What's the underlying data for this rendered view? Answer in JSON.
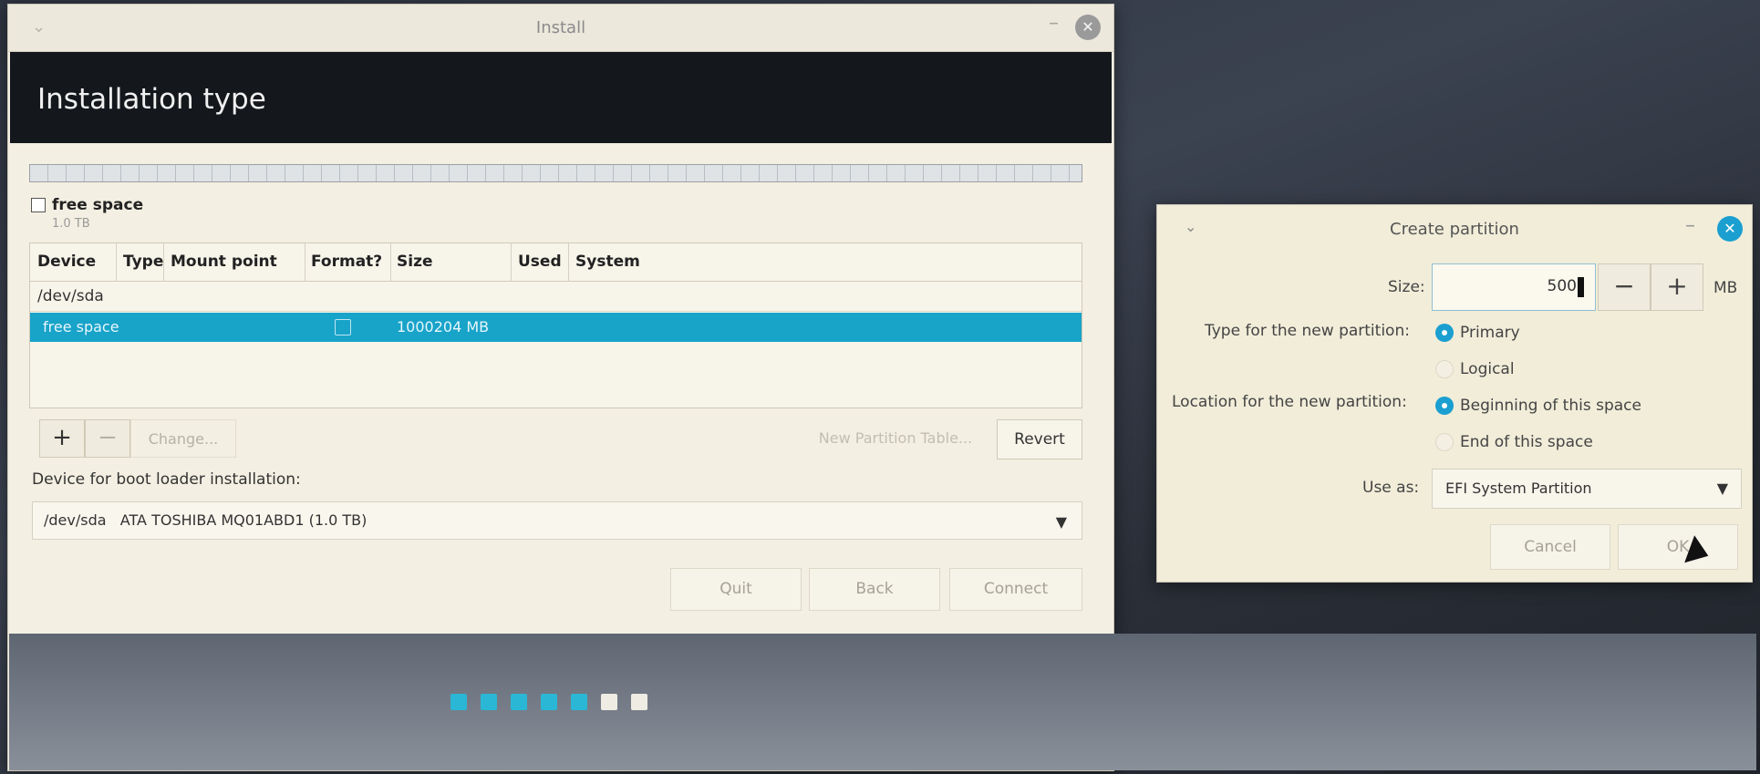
{
  "install": {
    "title": "Install",
    "header": "Installation type",
    "legend": {
      "label": "free space",
      "size": "1.0 TB"
    },
    "table": {
      "columns": [
        "Device",
        "Type",
        "Mount point",
        "Format?",
        "Size",
        "Used",
        "System"
      ],
      "device_row": "/dev/sda",
      "free_row": {
        "device": "free space",
        "size": "1000204 MB",
        "selected": true
      }
    },
    "toolbar": {
      "add": "+",
      "remove": "−",
      "change": "Change...",
      "new_partition_table": "New Partition Table...",
      "revert": "Revert"
    },
    "boot_loader": {
      "label": "Device for boot loader installation:",
      "value": "/dev/sda   ATA TOSHIBA MQ01ABD1 (1.0 TB)"
    },
    "nav": {
      "quit": "Quit",
      "back": "Back",
      "connect": "Connect"
    },
    "progress": {
      "total_steps": 7,
      "completed_steps": 5
    }
  },
  "dialog": {
    "title": "Create partition",
    "size_label": "Size:",
    "size_value": "500",
    "size_unit": "MB",
    "minus": "−",
    "plus": "+",
    "type_label": "Type for the new partition:",
    "type_options": [
      "Primary",
      "Logical"
    ],
    "type_selected": "Primary",
    "location_label": "Location for the new partition:",
    "location_options": [
      "Beginning of this space",
      "End of this space"
    ],
    "location_selected": "Beginning of this space",
    "use_as_label": "Use as:",
    "use_as_value": "EFI System Partition",
    "cancel": "Cancel",
    "ok": "OK"
  },
  "colors": {
    "accent": "#1a9fd0",
    "selection": "#18a3c9",
    "header_band": "#14171c"
  }
}
